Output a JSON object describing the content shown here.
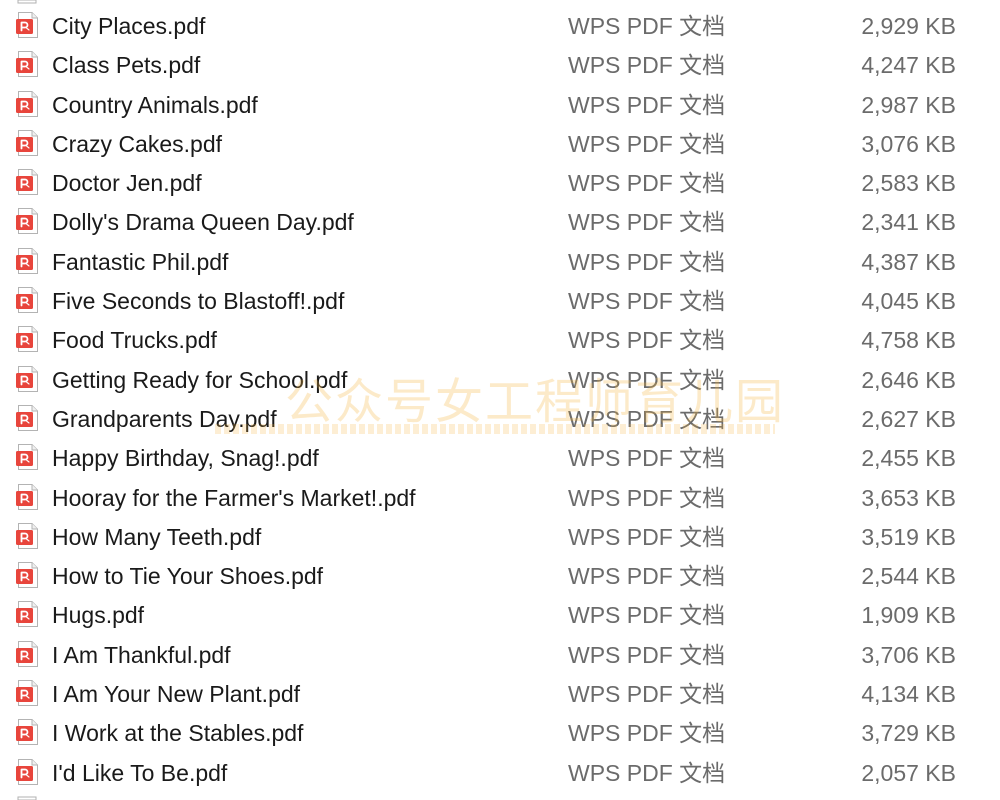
{
  "file_list": {
    "rows": [
      {
        "name": "City Places.pdf",
        "type": "WPS PDF 文档",
        "size": "2,929 KB"
      },
      {
        "name": "Class Pets.pdf",
        "type": "WPS PDF 文档",
        "size": "4,247 KB"
      },
      {
        "name": "Country Animals.pdf",
        "type": "WPS PDF 文档",
        "size": "2,987 KB"
      },
      {
        "name": "Crazy Cakes.pdf",
        "type": "WPS PDF 文档",
        "size": "3,076 KB"
      },
      {
        "name": "Doctor Jen.pdf",
        "type": "WPS PDF 文档",
        "size": "2,583 KB"
      },
      {
        "name": "Dolly's Drama Queen Day.pdf",
        "type": "WPS PDF 文档",
        "size": "2,341 KB"
      },
      {
        "name": "Fantastic Phil.pdf",
        "type": "WPS PDF 文档",
        "size": "4,387 KB"
      },
      {
        "name": "Five Seconds to Blastoff!.pdf",
        "type": "WPS PDF 文档",
        "size": "4,045 KB"
      },
      {
        "name": "Food Trucks.pdf",
        "type": "WPS PDF 文档",
        "size": "4,758 KB"
      },
      {
        "name": "Getting Ready for School.pdf",
        "type": "WPS PDF 文档",
        "size": "2,646 KB"
      },
      {
        "name": "Grandparents Day.pdf",
        "type": "WPS PDF 文档",
        "size": "2,627 KB"
      },
      {
        "name": "Happy Birthday, Snag!.pdf",
        "type": "WPS PDF 文档",
        "size": "2,455 KB"
      },
      {
        "name": "Hooray for the Farmer's Market!.pdf",
        "type": "WPS PDF 文档",
        "size": "3,653 KB"
      },
      {
        "name": "How Many Teeth.pdf",
        "type": "WPS PDF 文档",
        "size": "3,519 KB"
      },
      {
        "name": "How to Tie Your Shoes.pdf",
        "type": "WPS PDF 文档",
        "size": "2,544 KB"
      },
      {
        "name": "Hugs.pdf",
        "type": "WPS PDF 文档",
        "size": "1,909 KB"
      },
      {
        "name": "I Am Thankful.pdf",
        "type": "WPS PDF 文档",
        "size": "3,706 KB"
      },
      {
        "name": "I Am Your New Plant.pdf",
        "type": "WPS PDF 文档",
        "size": "4,134 KB"
      },
      {
        "name": "I Work at the Stables.pdf",
        "type": "WPS PDF 文档",
        "size": "3,729 KB"
      },
      {
        "name": "I'd Like To Be.pdf",
        "type": "WPS PDF 文档",
        "size": "2,057 KB"
      }
    ],
    "icon": "pdf-file-icon",
    "colors": {
      "icon_red": "#e8453c",
      "name_text": "#1a1a1a",
      "meta_text": "#6b6b6b"
    }
  },
  "watermark": {
    "text": "公众号女工程师育儿园"
  }
}
